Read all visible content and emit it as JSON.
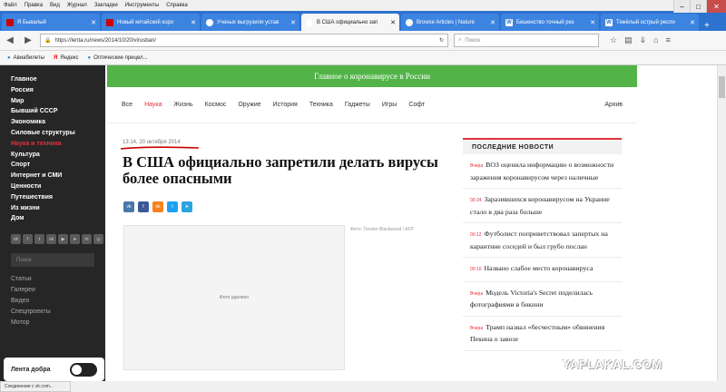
{
  "menu": [
    "Файл",
    "Правка",
    "Вид",
    "Журнал",
    "Закладки",
    "Инструменты",
    "Справка"
  ],
  "tabs": [
    {
      "label": "Я Бывалый",
      "icon": "red"
    },
    {
      "label": "Новый китайский коро",
      "icon": "red"
    },
    {
      "label": "Ученых выгрузили устав",
      "icon": "circle"
    },
    {
      "label": "В США официально зап",
      "icon": "circle"
    },
    {
      "label": "Browse Articles | Nature",
      "icon": "circle"
    },
    {
      "label": "Бешенство точный рез",
      "icon": "w"
    },
    {
      "label": "Тяжёлый острый респи",
      "icon": "w"
    }
  ],
  "address": {
    "url": "https://lenta.ru/news/2014/10/20/virusban/",
    "search_placeholder": "Поиск"
  },
  "bookmarks": [
    "Авиабилеты",
    "Яндекс",
    "Оптические прицел..."
  ],
  "sidebar": {
    "items": [
      "Главное",
      "Россия",
      "Мир",
      "Бывший СССР",
      "Экономика",
      "Силовые структуры",
      "Наука и техника",
      "Культура",
      "Спорт",
      "Интернет и СМИ",
      "Ценности",
      "Путешествия",
      "Из жизни",
      "Дом"
    ],
    "search_placeholder": "Поиск",
    "secondary": [
      "Статьи",
      "Галереи",
      "Видео",
      "Спецпроекты",
      "Мотор"
    ],
    "toggle_label": "Лента добра"
  },
  "banner": "Главное о коронавирусе в России",
  "catnav": [
    "Все",
    "Наука",
    "Жизнь",
    "Космос",
    "Оружие",
    "История",
    "Техника",
    "Гаджеты",
    "Игры",
    "Софт"
  ],
  "archive": "Архив",
  "article": {
    "date": "13:14, 20 октября 2014",
    "title": "В США официально запретили делать вирусы более опасными",
    "photo_placeholder": "Фото удалено",
    "photo_credit": "Фото: Torsten Blackwood / AFP"
  },
  "news": {
    "heading": "ПОСЛЕДНИЕ НОВОСТИ",
    "items": [
      {
        "time": "Вчера",
        "text": "ВОЗ оценила информацию о возможности заражения коронавирусом через наличные"
      },
      {
        "time": "00:24",
        "text": "Заразившихся коронавирусом на Украине стало в два раза больше"
      },
      {
        "time": "00:12",
        "text": "Футболист поприветствовал запертых на карантине соседей и был грубо послан"
      },
      {
        "time": "00:10",
        "text": "Названо слабое место коронавируса"
      },
      {
        "time": "Вчера",
        "text": "Модель Victoria's Secret поделилась фотографиями в бикини"
      },
      {
        "time": "Вчера",
        "text": "Трамп назвал «бесчестным» обвинения Пекина о завозе"
      }
    ]
  },
  "watermark": "YAPLAKAL.COM",
  "status": "Соединение с vk.com..."
}
